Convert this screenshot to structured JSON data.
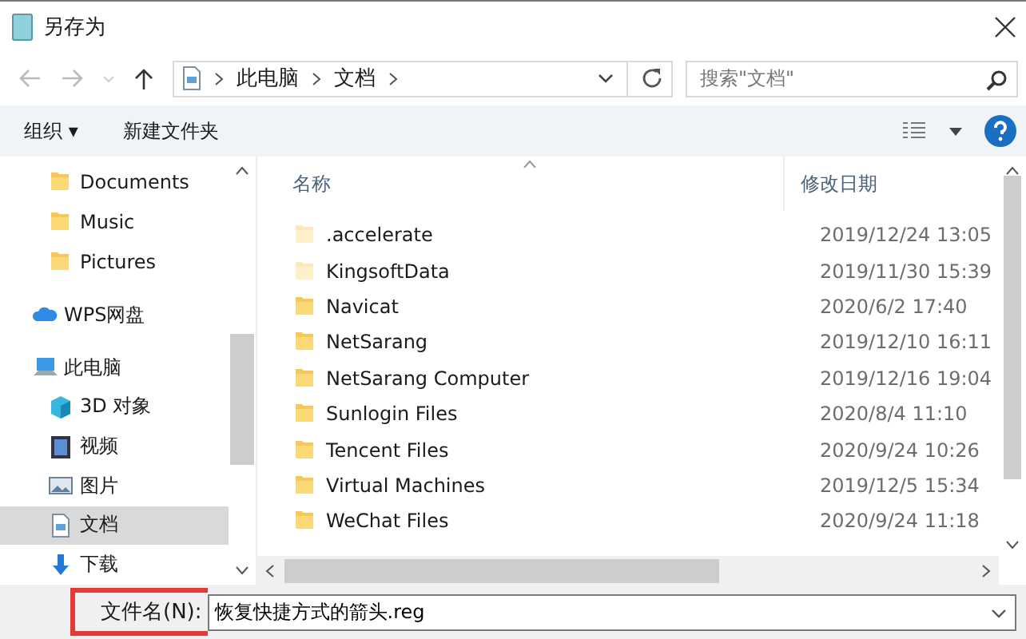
{
  "window": {
    "title": "另存为"
  },
  "address_bar": {
    "path": [
      "此电脑",
      "文档"
    ]
  },
  "search": {
    "placeholder": "搜索\"文档\""
  },
  "toolbar": {
    "organize": "组织 ▾",
    "new_folder": "新建文件夹"
  },
  "nav": {
    "items": [
      {
        "label": "Documents",
        "kind": "folder",
        "selected": false
      },
      {
        "label": "Music",
        "kind": "folder",
        "selected": false
      },
      {
        "label": "Pictures",
        "kind": "folder",
        "selected": false
      },
      {
        "label": "WPS网盘",
        "kind": "cloud",
        "selected": false
      },
      {
        "label": "此电脑",
        "kind": "pc",
        "selected": false,
        "children": [
          {
            "label": "3D 对象",
            "kind": "cube",
            "selected": false
          },
          {
            "label": "视频",
            "kind": "video",
            "selected": false
          },
          {
            "label": "图片",
            "kind": "pictures",
            "selected": false
          },
          {
            "label": "文档",
            "kind": "documents",
            "selected": true
          },
          {
            "label": "下载",
            "kind": "download",
            "selected": false
          }
        ]
      }
    ]
  },
  "table": {
    "columns": [
      "名称",
      "修改日期"
    ],
    "rows": [
      {
        "name": ".accelerate",
        "date": "2019/12/24 13:05",
        "faded": true
      },
      {
        "name": "KingsoftData",
        "date": "2019/11/30 15:39",
        "faded": true
      },
      {
        "name": "Navicat",
        "date": "2020/6/2 17:40",
        "faded": false
      },
      {
        "name": "NetSarang",
        "date": "2019/12/10 16:11",
        "faded": false
      },
      {
        "name": "NetSarang Computer",
        "date": "2019/12/16 19:04",
        "faded": false
      },
      {
        "name": "Sunlogin Files",
        "date": "2020/8/4 11:10",
        "faded": false
      },
      {
        "name": "Tencent Files",
        "date": "2020/9/24 10:26",
        "faded": false
      },
      {
        "name": "Virtual Machines",
        "date": "2019/12/5 15:34",
        "faded": false
      },
      {
        "name": "WeChat Files",
        "date": "2020/9/24 11:18",
        "faded": false
      }
    ]
  },
  "filename": {
    "label": "文件名(N):",
    "value": "恢复快捷方式的箭头.reg",
    "highlighted": true
  }
}
